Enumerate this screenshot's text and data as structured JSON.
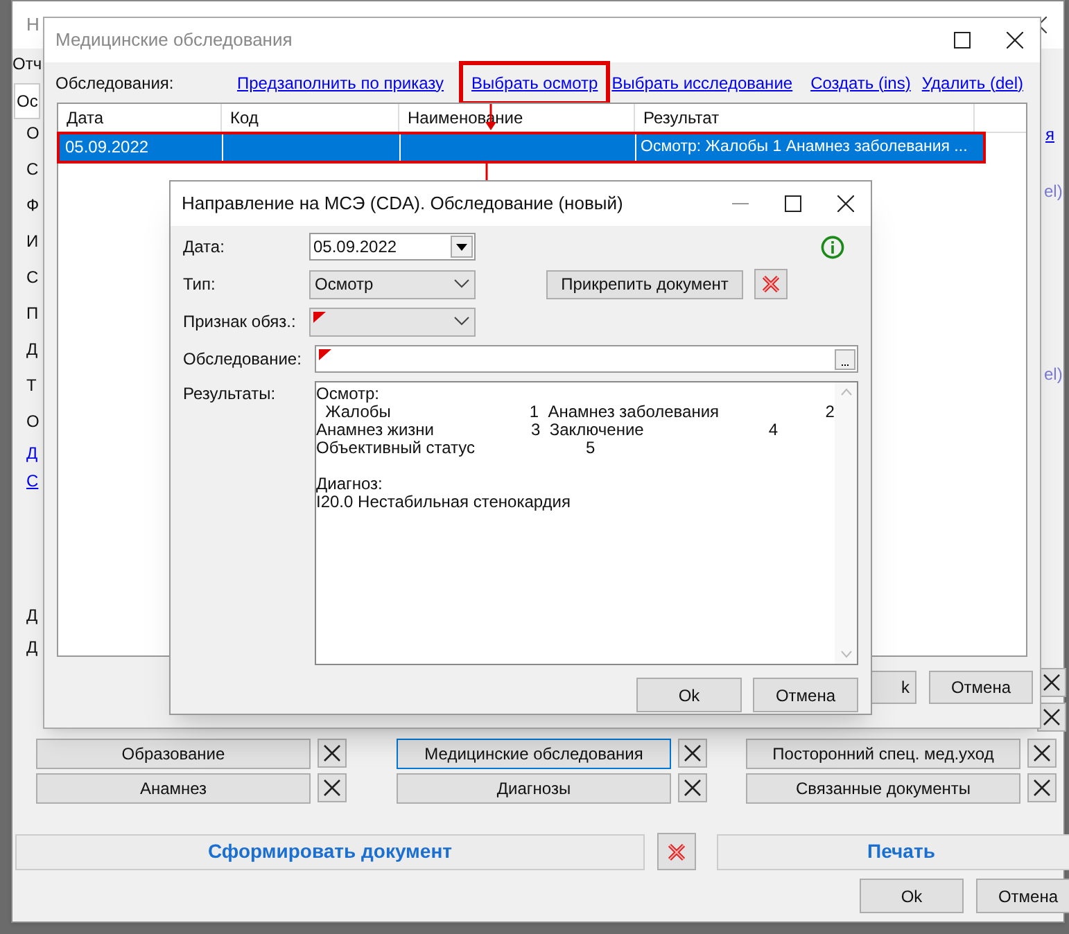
{
  "main_window": {
    "title": "Н",
    "menu": [
      "Отч"
    ],
    "tab": "Ос",
    "side_labels": [
      {
        "text": "О",
        "kind": "label"
      },
      {
        "text": "С",
        "kind": "label"
      },
      {
        "text": "Ф",
        "kind": "label"
      },
      {
        "text": "И",
        "kind": "label"
      },
      {
        "text": "С",
        "kind": "label"
      },
      {
        "text": "П",
        "kind": "label"
      },
      {
        "text": "Д",
        "kind": "label"
      },
      {
        "text": "Т",
        "kind": "label"
      },
      {
        "text": "О",
        "kind": "label"
      },
      {
        "text": "Д",
        "kind": "link"
      },
      {
        "text": "С",
        "kind": "link"
      }
    ],
    "lower_labels": [
      "Д",
      "Д"
    ],
    "right_link": "я",
    "right_labels": [
      "el)",
      "el)"
    ],
    "section_rows": [
      [
        {
          "label": "Образование",
          "focused": false
        },
        {
          "label": "Медицинские обследования",
          "focused": true
        },
        {
          "label": "Посторонний спец. мед.уход",
          "focused": false
        }
      ],
      [
        {
          "label": "Анамнез",
          "focused": false
        },
        {
          "label": "Диагнозы",
          "focused": false
        },
        {
          "label": "Связанные документы",
          "focused": false
        }
      ]
    ],
    "generate_button": "Сформировать документ",
    "print_button": "Печать",
    "ok_button": "Ok",
    "cancel_button": "Отмена"
  },
  "exams_dialog": {
    "title": "Медицинские обследования",
    "label": "Обследования:",
    "links": [
      {
        "label": "Предзаполнить по приказу",
        "highlighted": false
      },
      {
        "label": "Выбрать осмотр",
        "highlighted": true
      },
      {
        "label": "Выбрать исследование",
        "highlighted": false
      },
      {
        "label": "Создать (ins)",
        "highlighted": false
      },
      {
        "label": "Удалить (del)",
        "highlighted": false
      }
    ],
    "columns": [
      "Дата",
      "Код",
      "Наименование",
      "Результат"
    ],
    "rows": [
      {
        "date": "05.09.2022",
        "result": "Осмотр:  Жалобы 1   Анамнез заболевания ...",
        "selected": true,
        "highlighted": true
      }
    ],
    "ok_button": "k",
    "cancel_button": "Отмена"
  },
  "exam_form": {
    "title": "Направление на МСЭ (CDA). Обследование (новый)",
    "date_label": "Дата:",
    "date_value": "05.09.2022",
    "type_label": "Тип:",
    "type_value": "Осмотр",
    "required_label": "Признак обяз.:",
    "required_missing": true,
    "attach_button": "Прикрепить документ",
    "exam_label": "Обследование:",
    "exam_missing": true,
    "results_label": "Результаты:",
    "results_lines": [
      "Осмотр:",
      "  Жалобы                              1  Анамнез заболевания                       2",
      "Анамнез жизни                     3  Заключение                           4",
      "Объективный статус                        5"
    ],
    "diagnosis_lines": [
      "Диагноз:",
      "I20.0 Нестабильная стенокардия"
    ],
    "ok_button": "Ok",
    "cancel_button": "Отмена"
  }
}
